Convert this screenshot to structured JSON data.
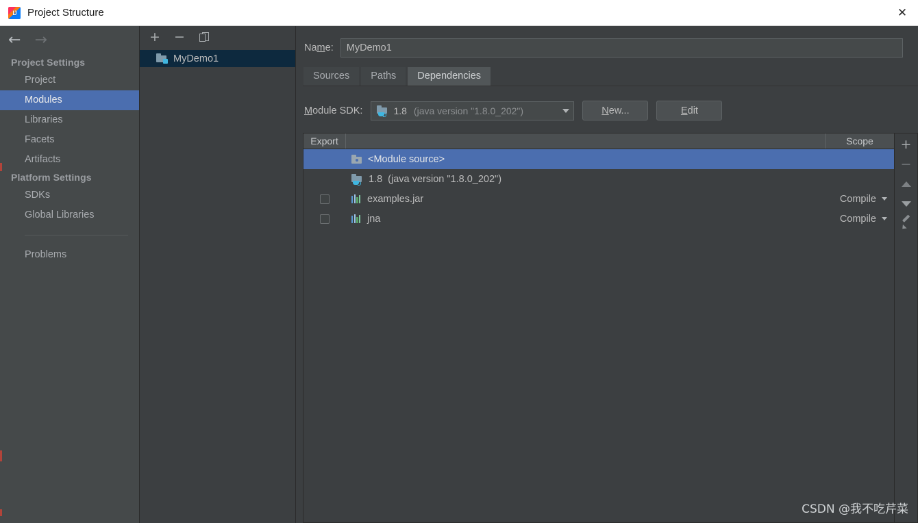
{
  "window": {
    "title": "Project Structure",
    "app_icon": "intellij-idea-icon",
    "close_label": "✕"
  },
  "nav": {
    "back_icon": "arrow-left-icon",
    "back_glyph": "←",
    "forward_icon": "arrow-right-icon",
    "forward_glyph": "→"
  },
  "sidebar": {
    "groups": [
      {
        "title": "Project Settings",
        "items": [
          {
            "label": "Project",
            "selected": false
          },
          {
            "label": "Modules",
            "selected": true
          },
          {
            "label": "Libraries",
            "selected": false
          },
          {
            "label": "Facets",
            "selected": false
          },
          {
            "label": "Artifacts",
            "selected": false
          }
        ]
      },
      {
        "title": "Platform Settings",
        "items": [
          {
            "label": "SDKs",
            "selected": false
          },
          {
            "label": "Global Libraries",
            "selected": false
          }
        ]
      }
    ],
    "problems_label": "Problems"
  },
  "module_tree": {
    "toolbar": [
      {
        "name": "add-module-button",
        "glyph": "+"
      },
      {
        "name": "remove-module-button",
        "glyph": "−"
      },
      {
        "name": "copy-module-button",
        "glyph": ""
      }
    ],
    "modules": [
      {
        "label": "MyDemo1",
        "selected": true
      }
    ]
  },
  "main": {
    "name_label": "Name:",
    "name_value": "MyDemo1",
    "name_placeholder": "",
    "tabs": [
      {
        "label": "Sources",
        "active": false
      },
      {
        "label": "Paths",
        "active": false
      },
      {
        "label": "Dependencies",
        "active": true
      }
    ],
    "sdk": {
      "label": "Module SDK:",
      "version": "1.8",
      "detail": "(java version \"1.8.0_202\")",
      "new_button": "New...",
      "edit_button": "Edit"
    },
    "table": {
      "headers": {
        "export": "Export",
        "name": "",
        "scope": "Scope"
      },
      "rows": [
        {
          "name": "<Module source>",
          "detail": "",
          "icon": "module-source-folder-icon",
          "has_checkbox": false,
          "checked": false,
          "scope": "",
          "selected": true
        },
        {
          "name": "1.8",
          "detail": "(java version \"1.8.0_202\")",
          "icon": "jdk-folder-icon",
          "has_checkbox": false,
          "checked": false,
          "scope": "",
          "selected": false
        },
        {
          "name": "examples.jar",
          "detail": "",
          "icon": "library-jar-icon",
          "has_checkbox": true,
          "checked": false,
          "scope": "Compile",
          "selected": false
        },
        {
          "name": "jna",
          "detail": "",
          "icon": "library-jar-icon",
          "has_checkbox": true,
          "checked": false,
          "scope": "Compile",
          "selected": false
        }
      ]
    },
    "actions": [
      {
        "name": "add-dependency-button",
        "glyph": "+",
        "enabled": true
      },
      {
        "name": "remove-dependency-button",
        "glyph": "−",
        "enabled": false
      },
      {
        "name": "move-up-button",
        "glyph": "",
        "enabled": true
      },
      {
        "name": "move-down-button",
        "glyph": "",
        "enabled": true
      },
      {
        "name": "edit-dependency-button",
        "glyph": "",
        "enabled": true
      }
    ]
  },
  "watermark": "CSDN @我不吃芹菜",
  "colors": {
    "accent_selection": "#4b6eaf",
    "window_bg": "#3c3f41",
    "sidebar_bg": "#45494a",
    "tree_selection": "#0d293e",
    "text_primary": "#bbbbbb",
    "text_muted": "#8f9295",
    "titlebar_bg": "#ffffff"
  }
}
